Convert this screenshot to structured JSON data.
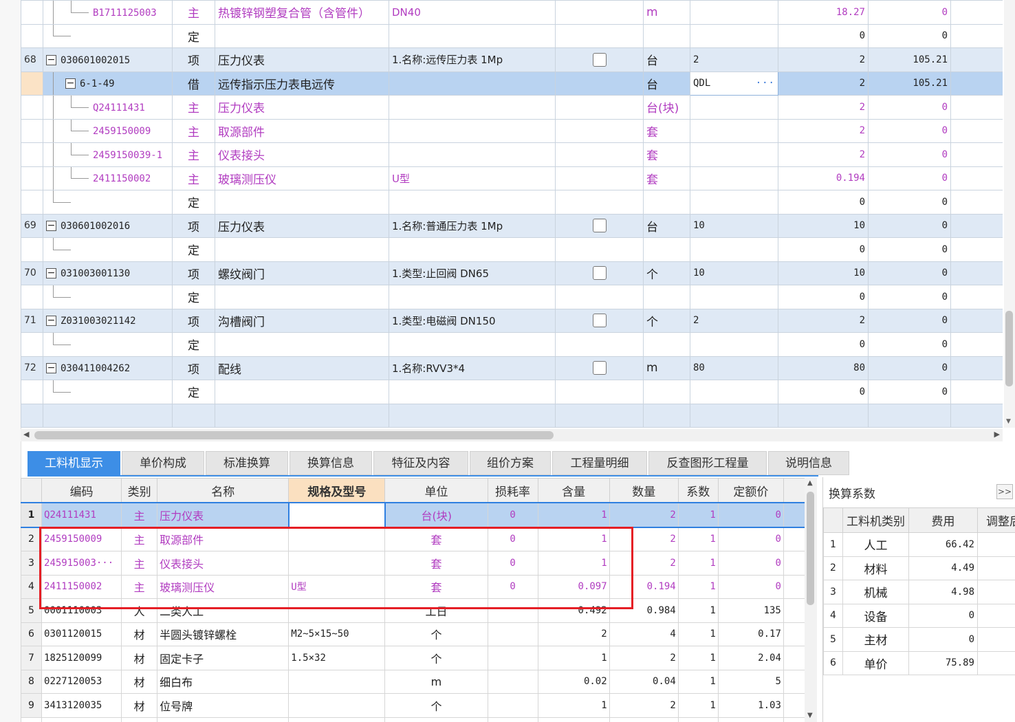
{
  "top_rows": [
    {
      "kind": "material",
      "no": "",
      "code": "B1711125003",
      "type": "主",
      "name": "热镀锌钢塑复合管（含管件）",
      "spec": "DN40",
      "check": false,
      "unit": "m",
      "expr": "",
      "qty": "18.27",
      "price": "0"
    },
    {
      "kind": "quota",
      "no": "",
      "code": "",
      "type": "定",
      "name": "",
      "spec": "",
      "check": false,
      "unit": "",
      "expr": "",
      "qty": "0",
      "price": "0"
    },
    {
      "kind": "item",
      "no": "68",
      "code": "030601002015",
      "type": "项",
      "name": "压力仪表",
      "spec": "1.名称:远传压力表 1Mp",
      "check": true,
      "unit": "台",
      "expr": "2",
      "qty": "2",
      "price": "105.21"
    },
    {
      "kind": "selected",
      "no": "",
      "code": "6-1-49",
      "type": "借",
      "name": "远传指示压力表电远传",
      "spec": "",
      "check": false,
      "unit": "台",
      "expr": "QDL",
      "qty": "2",
      "price": "105.21"
    },
    {
      "kind": "material",
      "no": "",
      "code": "Q24111431",
      "type": "主",
      "name": "压力仪表",
      "spec": "",
      "check": false,
      "unit": "台(块)",
      "expr": "",
      "qty": "2",
      "price": "0"
    },
    {
      "kind": "material",
      "no": "",
      "code": "2459150009",
      "type": "主",
      "name": "取源部件",
      "spec": "",
      "check": false,
      "unit": "套",
      "expr": "",
      "qty": "2",
      "price": "0"
    },
    {
      "kind": "material",
      "no": "",
      "code": "2459150039-1",
      "type": "主",
      "name": "仪表接头",
      "spec": "",
      "check": false,
      "unit": "套",
      "expr": "",
      "qty": "2",
      "price": "0"
    },
    {
      "kind": "material",
      "no": "",
      "code": "2411150002",
      "type": "主",
      "name": "玻璃测压仪",
      "spec": "U型",
      "check": false,
      "unit": "套",
      "expr": "",
      "qty": "0.194",
      "price": "0"
    },
    {
      "kind": "quota",
      "no": "",
      "code": "",
      "type": "定",
      "name": "",
      "spec": "",
      "check": false,
      "unit": "",
      "expr": "",
      "qty": "0",
      "price": "0"
    },
    {
      "kind": "item",
      "no": "69",
      "code": "030601002016",
      "type": "项",
      "name": "压力仪表",
      "spec": "1.名称:普通压力表 1Mp",
      "check": true,
      "unit": "台",
      "expr": "10",
      "qty": "10",
      "price": "0"
    },
    {
      "kind": "quota",
      "no": "",
      "code": "",
      "type": "定",
      "name": "",
      "spec": "",
      "check": false,
      "unit": "",
      "expr": "",
      "qty": "0",
      "price": "0"
    },
    {
      "kind": "item",
      "no": "70",
      "code": "031003001130",
      "type": "项",
      "name": "螺纹阀门",
      "spec": "1.类型:止回阀 DN65",
      "check": true,
      "unit": "个",
      "expr": "10",
      "qty": "10",
      "price": "0"
    },
    {
      "kind": "quota",
      "no": "",
      "code": "",
      "type": "定",
      "name": "",
      "spec": "",
      "check": false,
      "unit": "",
      "expr": "",
      "qty": "0",
      "price": "0"
    },
    {
      "kind": "item",
      "no": "71",
      "code": "Z031003021142",
      "type": "项",
      "name": "沟槽阀门",
      "spec": "1.类型:电磁阀 DN150",
      "check": true,
      "unit": "个",
      "expr": "2",
      "qty": "2",
      "price": "0"
    },
    {
      "kind": "quota",
      "no": "",
      "code": "",
      "type": "定",
      "name": "",
      "spec": "",
      "check": false,
      "unit": "",
      "expr": "",
      "qty": "0",
      "price": "0"
    },
    {
      "kind": "item",
      "no": "72",
      "code": "030411004262",
      "type": "项",
      "name": "配线",
      "spec": "1.名称:RVV3*4",
      "check": true,
      "unit": "m",
      "expr": "80",
      "qty": "80",
      "price": "0"
    },
    {
      "kind": "quota",
      "no": "",
      "code": "",
      "type": "定",
      "name": "",
      "spec": "",
      "check": false,
      "unit": "",
      "expr": "",
      "qty": "0",
      "price": "0"
    }
  ],
  "tabs": [
    "工料机显示",
    "单价构成",
    "标准换算",
    "换算信息",
    "特征及内容",
    "组价方案",
    "工程量明细",
    "反查图形工程量",
    "说明信息"
  ],
  "bottom_headers": [
    "编码",
    "类别",
    "名称",
    "规格及型号",
    "单位",
    "损耗率",
    "含量",
    "数量",
    "系数",
    "定额价"
  ],
  "bottom_rows": [
    {
      "n": "1",
      "code": "Q24111431",
      "cat": "主",
      "name": "压力仪表",
      "spec": "",
      "unit": "台(块)",
      "loss": "0",
      "content": "1",
      "qty": "2",
      "coef": "1",
      "price": "0"
    },
    {
      "n": "2",
      "code": "2459150009",
      "cat": "主",
      "name": "取源部件",
      "spec": "",
      "unit": "套",
      "loss": "0",
      "content": "1",
      "qty": "2",
      "coef": "1",
      "price": "0"
    },
    {
      "n": "3",
      "code": "245915003···",
      "cat": "主",
      "name": "仪表接头",
      "spec": "",
      "unit": "套",
      "loss": "0",
      "content": "1",
      "qty": "2",
      "coef": "1",
      "price": "0"
    },
    {
      "n": "4",
      "code": "2411150002",
      "cat": "主",
      "name": "玻璃测压仪",
      "spec": "U型",
      "unit": "套",
      "loss": "0",
      "content": "0.097",
      "qty": "0.194",
      "coef": "1",
      "price": "0"
    },
    {
      "n": "5",
      "code": "0001110003",
      "cat": "人",
      "name": "二类人工",
      "spec": "",
      "unit": "工日",
      "loss": "",
      "content": "0.492",
      "qty": "0.984",
      "coef": "1",
      "price": "135"
    },
    {
      "n": "6",
      "code": "0301120015",
      "cat": "材",
      "name": "半圆头镀锌螺栓",
      "spec": "M2~5×15~50",
      "unit": "个",
      "loss": "",
      "content": "2",
      "qty": "4",
      "coef": "1",
      "price": "0.17"
    },
    {
      "n": "7",
      "code": "1825120099",
      "cat": "材",
      "name": "固定卡子",
      "spec": "1.5×32",
      "unit": "个",
      "loss": "",
      "content": "1",
      "qty": "2",
      "coef": "1",
      "price": "2.04"
    },
    {
      "n": "8",
      "code": "0227120053",
      "cat": "材",
      "name": "细白布",
      "spec": "",
      "unit": "m",
      "loss": "",
      "content": "0.02",
      "qty": "0.04",
      "coef": "1",
      "price": "5"
    },
    {
      "n": "9",
      "code": "3413120035",
      "cat": "材",
      "name": "位号牌",
      "spec": "",
      "unit": "个",
      "loss": "",
      "content": "1",
      "qty": "2",
      "coef": "1",
      "price": "1.03"
    }
  ],
  "right_panel": {
    "title": "换算系数",
    "expand": ">>",
    "headers": [
      "工料机类别",
      "费用",
      "调整后"
    ],
    "rows": [
      {
        "n": "1",
        "cat": "人工",
        "fee": "66.42"
      },
      {
        "n": "2",
        "cat": "材料",
        "fee": "4.49"
      },
      {
        "n": "3",
        "cat": "机械",
        "fee": "4.98"
      },
      {
        "n": "4",
        "cat": "设备",
        "fee": "0"
      },
      {
        "n": "5",
        "cat": "主材",
        "fee": "0"
      },
      {
        "n": "6",
        "cat": "单价",
        "fee": "75.89"
      }
    ]
  },
  "colors": {
    "accent": "#3d8ee6",
    "material_text": "#b13cc0",
    "highlight_box": "#e51e25",
    "selected_row": "#b9d3f1"
  }
}
